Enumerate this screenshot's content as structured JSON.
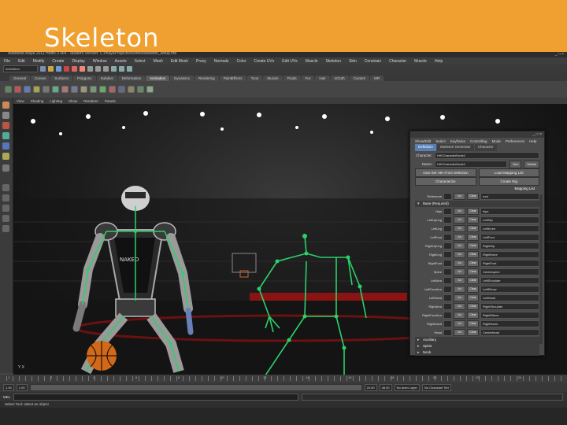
{
  "slide": {
    "title": "Skeleton"
  },
  "window": {
    "title": "Autodesk Maya 2011 Hotfix 3 x64 - Student Version: C:/mayaProjects/scenes/skeleton_setup.mb",
    "controls": "_ □ ×"
  },
  "menubar": [
    "File",
    "Edit",
    "Modify",
    "Create",
    "Display",
    "Window",
    "Assets",
    "Select",
    "Mesh",
    "Edit Mesh",
    "Proxy",
    "Normals",
    "Color",
    "Create UVs",
    "Edit UVs",
    "Muscle",
    "Skeleton",
    "Skin",
    "Constrain",
    "Character",
    "Muscle",
    "Help"
  ],
  "statusline": {
    "mode": "Animation"
  },
  "shelf_tabs": [
    {
      "label": "General",
      "active": false
    },
    {
      "label": "Curves",
      "active": false
    },
    {
      "label": "Surfaces",
      "active": false
    },
    {
      "label": "Polygons",
      "active": false
    },
    {
      "label": "Subdivs",
      "active": false
    },
    {
      "label": "Deformation",
      "active": false
    },
    {
      "label": "Animation",
      "active": true
    },
    {
      "label": "Dynamics",
      "active": false
    },
    {
      "label": "Rendering",
      "active": false
    },
    {
      "label": "PaintEffects",
      "active": false
    },
    {
      "label": "Toon",
      "active": false
    },
    {
      "label": "Muscle",
      "active": false
    },
    {
      "label": "Fluids",
      "active": false
    },
    {
      "label": "Fur",
      "active": false
    },
    {
      "label": "Hair",
      "active": false
    },
    {
      "label": "nCloth",
      "active": false
    },
    {
      "label": "Custom",
      "active": false
    },
    {
      "label": "MR",
      "active": false
    }
  ],
  "viewport_menu": [
    "View",
    "Shading",
    "Lighting",
    "Show",
    "Renderer",
    "Panels"
  ],
  "viewport": {
    "axis_label": "Y X"
  },
  "character_controls": {
    "menu": [
      "Show/Edit",
      "Select",
      "Keyframe",
      "Controlling",
      "Mode",
      "Preferences",
      "Help"
    ],
    "tabs": [
      {
        "label": "Definition",
        "active": true
      },
      {
        "label": "Skeleton Generator",
        "active": false
      },
      {
        "label": "Character",
        "active": false
      }
    ],
    "character_label": "Character:",
    "character_value": "HIKCharacterNode1",
    "name_label": "Name:",
    "name_value": "HIKCharacterNode1",
    "rename_btn": "Ren",
    "delete_btn": "Delete",
    "buttons_row1": [
      "Auto-Set HIK From Selection",
      "Load Mapping List"
    ],
    "buttons_row2": [
      "Characterize",
      "Create Rig"
    ],
    "mapping_header": "Mapping List",
    "ref_label": "Reference",
    "ref_value": "root",
    "section_base": "Base (Required)",
    "add_label": "Ad",
    "clear_label": "Clear",
    "mappings": [
      {
        "name": "Hips",
        "value": "hips"
      },
      {
        "name": "LeftUpLeg",
        "value": "LeftHip"
      },
      {
        "name": "LeftLeg",
        "value": "LeftKnee"
      },
      {
        "name": "LeftFoot",
        "value": "LeftFoot"
      },
      {
        "name": "RightUpLeg",
        "value": "RightHip"
      },
      {
        "name": "RightLeg",
        "value": "RightKnee"
      },
      {
        "name": "RightFoot",
        "value": "RightFoot"
      },
      {
        "name": "Spine",
        "value": "Centerspine"
      },
      {
        "name": "LeftArm",
        "value": "LeftShoulder"
      },
      {
        "name": "LeftForeArm",
        "value": "LeftElbow"
      },
      {
        "name": "LeftHand",
        "value": "LeftHand"
      },
      {
        "name": "RightArm",
        "value": "RightShoulder"
      },
      {
        "name": "RightForeArm",
        "value": "RightElbow"
      },
      {
        "name": "RightHand",
        "value": "RightHand"
      },
      {
        "name": "Head",
        "value": "Centerhead"
      }
    ],
    "sections_collapsed": [
      "Auxiliary",
      "Spine",
      "Neck"
    ]
  },
  "timeline": {
    "labels": [
      "1",
      "2",
      "4",
      "6",
      "8",
      "10",
      "12",
      "14",
      "16",
      "18",
      "20",
      "22",
      "24"
    ]
  },
  "range": {
    "start": "1.00",
    "start_inner": "1.00",
    "end_inner": "24.00",
    "end": "48.00",
    "current": "1.00",
    "anim_layer": "No Anim Layer",
    "char_set": "No Character Set"
  },
  "cmdline": {
    "label": "MEL"
  },
  "helpline": {
    "text": "Select Tool: select an object"
  },
  "colors": {
    "banner": "#f0a030",
    "skeleton": "#2bd16a",
    "active_tab": "#5a7fb4"
  }
}
